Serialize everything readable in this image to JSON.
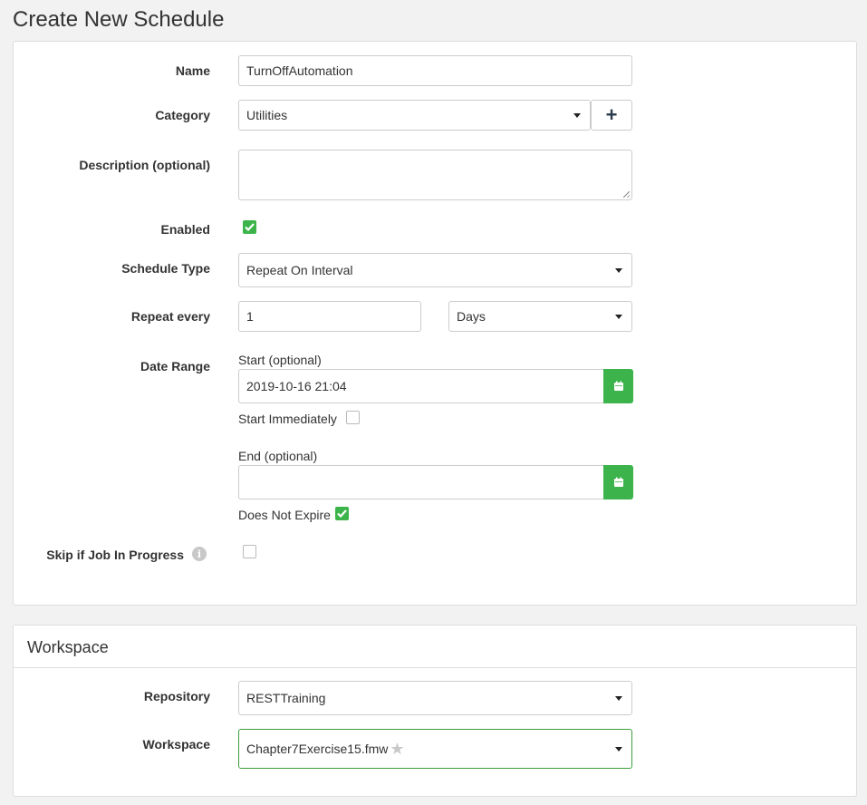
{
  "page": {
    "title": "Create New Schedule"
  },
  "schedule": {
    "name_label": "Name",
    "name_value": "TurnOffAutomation",
    "category_label": "Category",
    "category_value": "Utilities",
    "category_add_label": "+",
    "description_label": "Description (optional)",
    "description_value": "",
    "enabled_label": "Enabled",
    "enabled": true,
    "schedule_type_label": "Schedule Type",
    "schedule_type_value": "Repeat On Interval",
    "repeat_every_label": "Repeat every",
    "repeat_every_value": "1",
    "repeat_unit_value": "Days",
    "date_range_label": "Date Range",
    "start_label": "Start (optional)",
    "start_value": "2019-10-16 21:04",
    "start_immediately_label": "Start Immediately",
    "start_immediately": false,
    "end_label": "End (optional)",
    "end_value": "",
    "does_not_expire_label": "Does Not Expire",
    "does_not_expire": true,
    "skip_label": "Skip if Job In Progress",
    "skip_info_icon": "i",
    "skip": false
  },
  "workspace_panel": {
    "heading": "Workspace",
    "repository_label": "Repository",
    "repository_value": "RESTTraining",
    "workspace_label": "Workspace",
    "workspace_value": "Chapter7Exercise15.fmw",
    "star_icon": "★"
  },
  "colors": {
    "accent": "#3cb44b",
    "focus_border": "#3c9e3c",
    "background": "#f2f2f2"
  }
}
